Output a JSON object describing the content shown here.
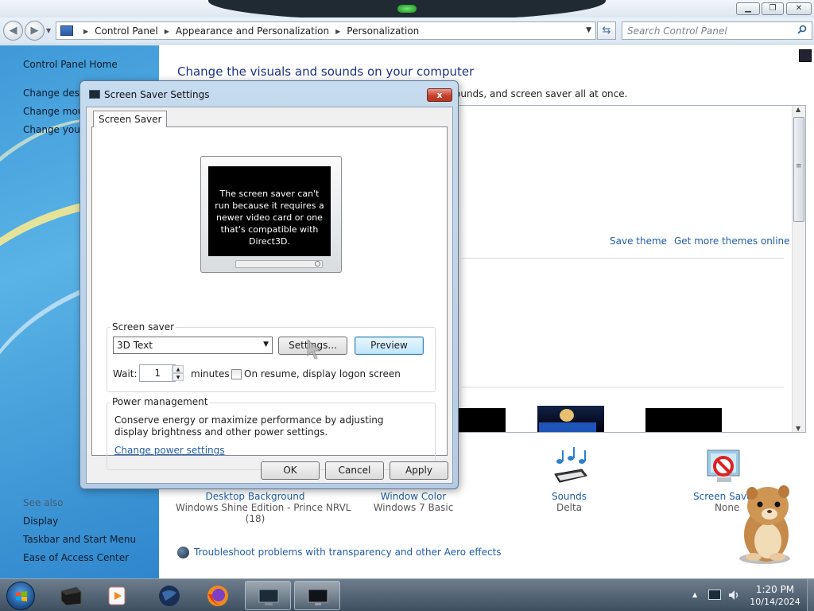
{
  "window": {
    "minimize_glyph": "▁",
    "maximize_glyph": "❐",
    "close_glyph": "✕"
  },
  "nav": {
    "back_glyph": "◀",
    "forward_glyph": "▶",
    "breadcrumbs": [
      "Control Panel",
      "Appearance and Personalization",
      "Personalization"
    ],
    "search_placeholder": "Search Control Panel"
  },
  "sidebar": {
    "home": "Control Panel Home",
    "items": [
      "Change deskt",
      "Change mous",
      "Change your"
    ],
    "see_also": "See also",
    "see_also_items": [
      "Display",
      "Taskbar and Start Menu",
      "Ease of Access Center"
    ]
  },
  "main": {
    "heading": "Change the visuals and sounds on your computer",
    "subtext": "ounds, and screen saver all at once.",
    "save_theme": "Save theme",
    "get_more_themes": "Get more themes online",
    "bottom_items": [
      {
        "label": "Desktop Background",
        "value": "Windows Shine Edition - Prince NRVL",
        "value2": "(18)"
      },
      {
        "label": "Window Color",
        "value": "Windows 7 Basic"
      },
      {
        "label": "Sounds",
        "value": "Delta"
      },
      {
        "label": "Screen Saver",
        "value": "None"
      }
    ],
    "troubleshoot": "Troubleshoot problems with transparency and other Aero effects"
  },
  "dialog": {
    "title": "Screen Saver Settings",
    "close_glyph": "x",
    "tab": "Screen Saver",
    "preview_message": "The screen saver can't run because it requires a newer video card or one that's compatible with Direct3D.",
    "screen_saver_group": "Screen saver",
    "selected_saver": "3D Text",
    "settings_button": "Settings...",
    "preview_button": "Preview",
    "wait_label": "Wait:",
    "wait_value": "1",
    "minutes_label": "minutes",
    "resume_label": "On resume, display logon screen",
    "resume_checked": false,
    "power_group": "Power management",
    "power_text": "Conserve energy or maximize performance by adjusting display brightness and other power settings.",
    "power_link": "Change power settings",
    "ok": "OK",
    "cancel": "Cancel",
    "apply": "Apply"
  },
  "taskbar": {
    "time": "1:20 PM",
    "date": "10/14/2024"
  },
  "colors": {
    "link": "#1f5ea8",
    "heading": "#1e3287",
    "left_pane": "#3f99d8",
    "dialog_frame": "#bcd2ea",
    "taskbar": "#4a5b6c"
  }
}
